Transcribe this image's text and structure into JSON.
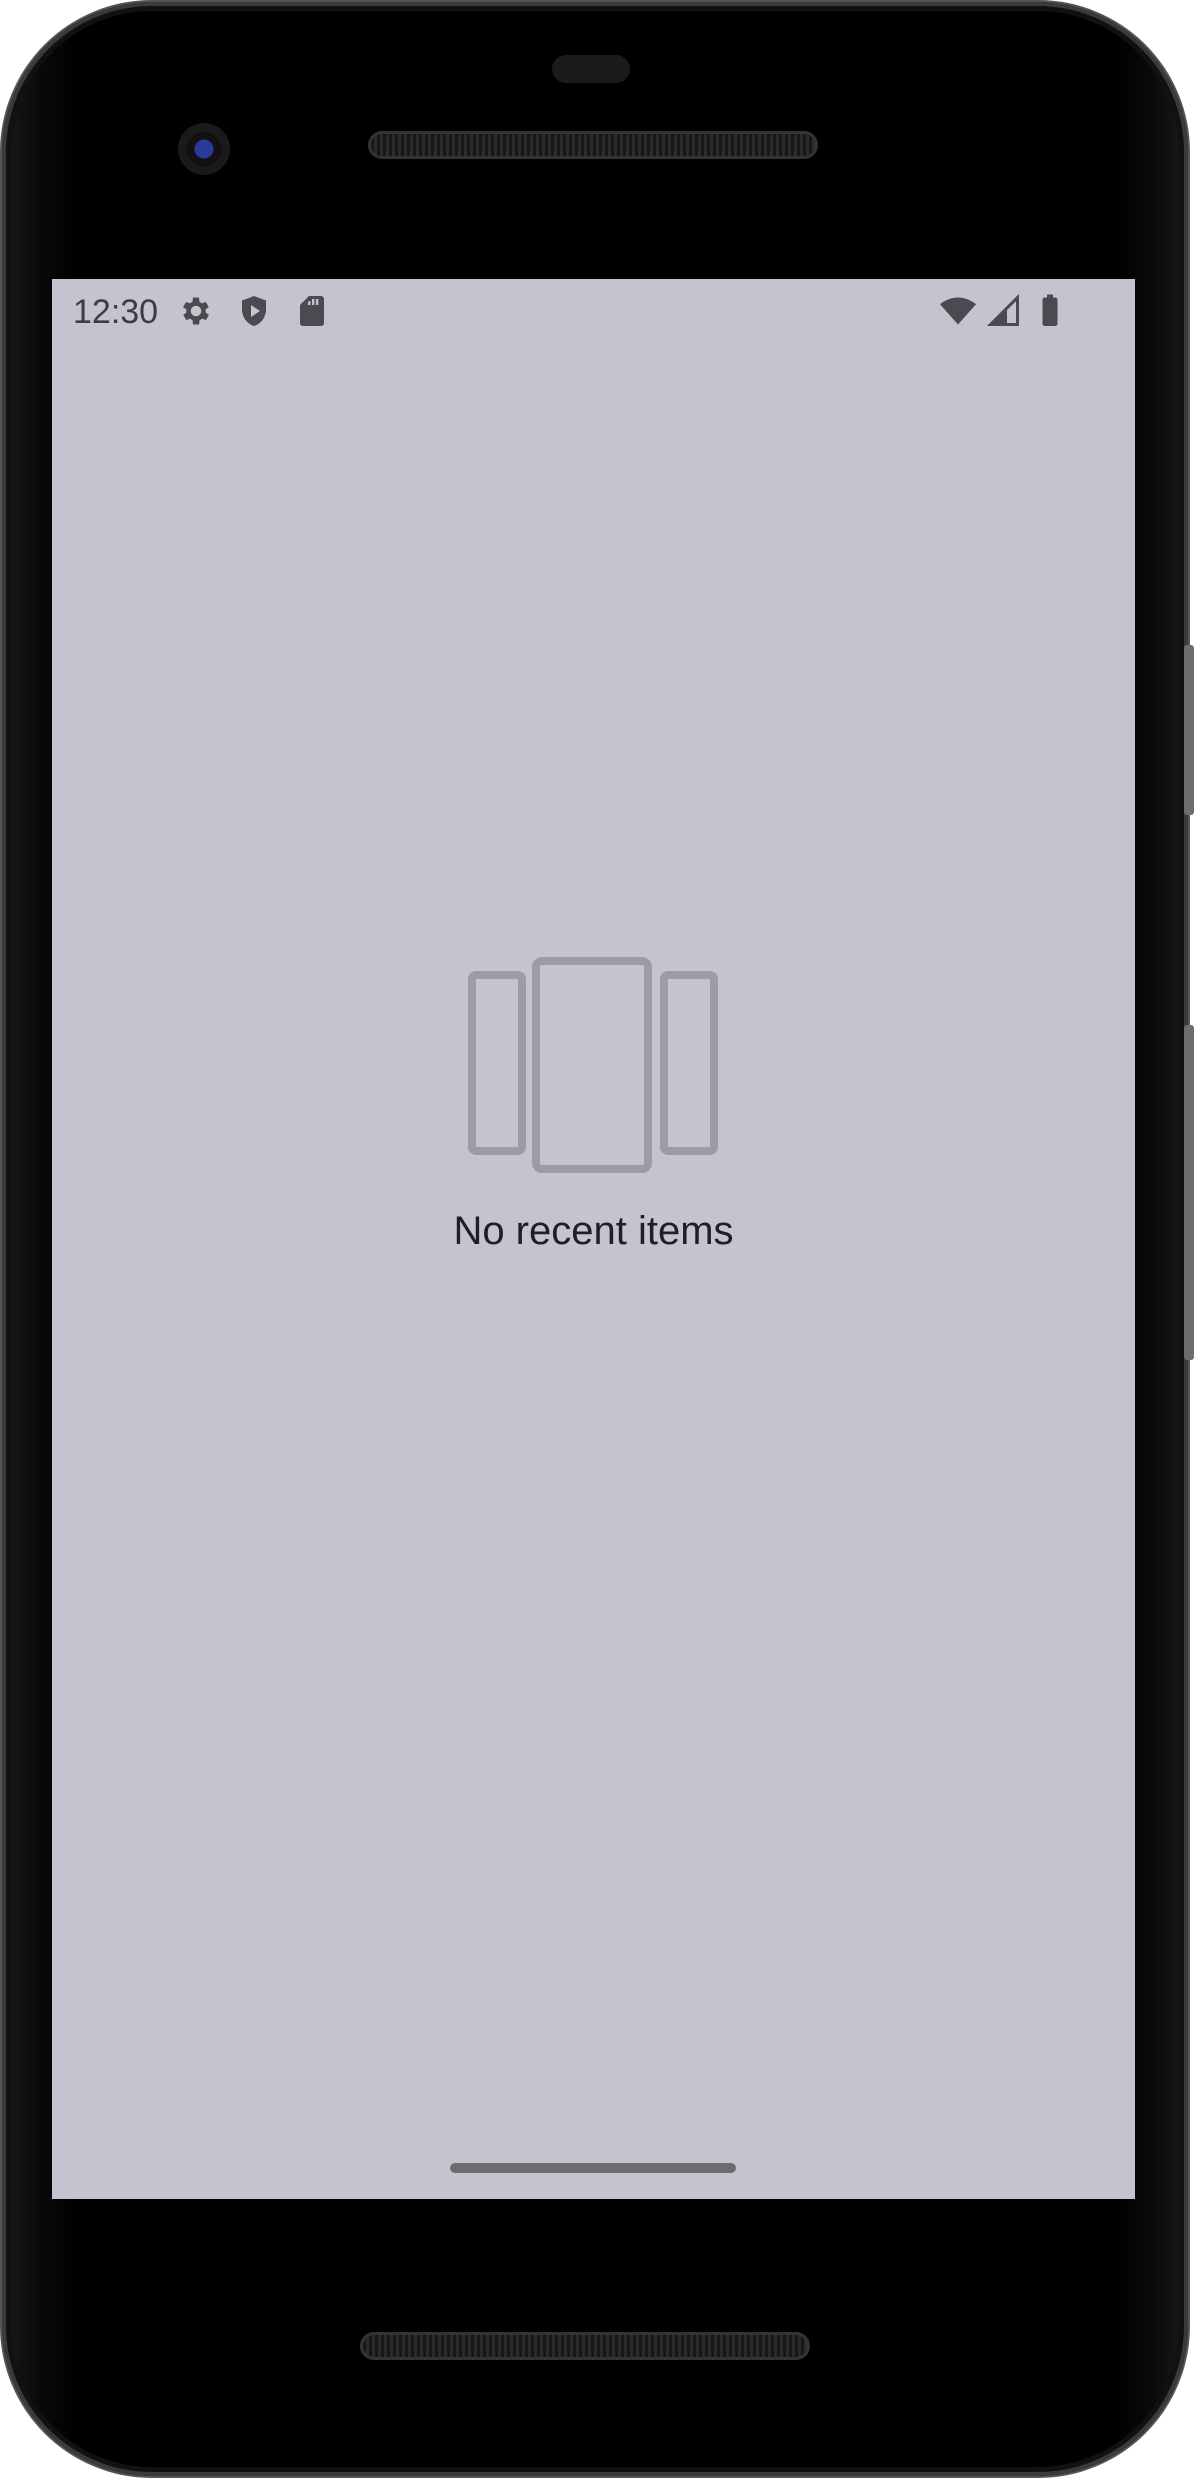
{
  "status_bar": {
    "time": "12:30",
    "icons_left": [
      "gear-icon",
      "shield-play-icon",
      "sd-card-icon"
    ],
    "icons_right": [
      "wifi-icon",
      "cell-signal-icon",
      "battery-icon"
    ]
  },
  "recents": {
    "empty_message": "No recent items",
    "empty_icon": "recents-icon"
  },
  "colors": {
    "screen_background": "#c5c4ce",
    "text_primary": "#1f1f24",
    "icon_muted": "#9d9ca3",
    "home_indicator": "#6c6c70"
  }
}
